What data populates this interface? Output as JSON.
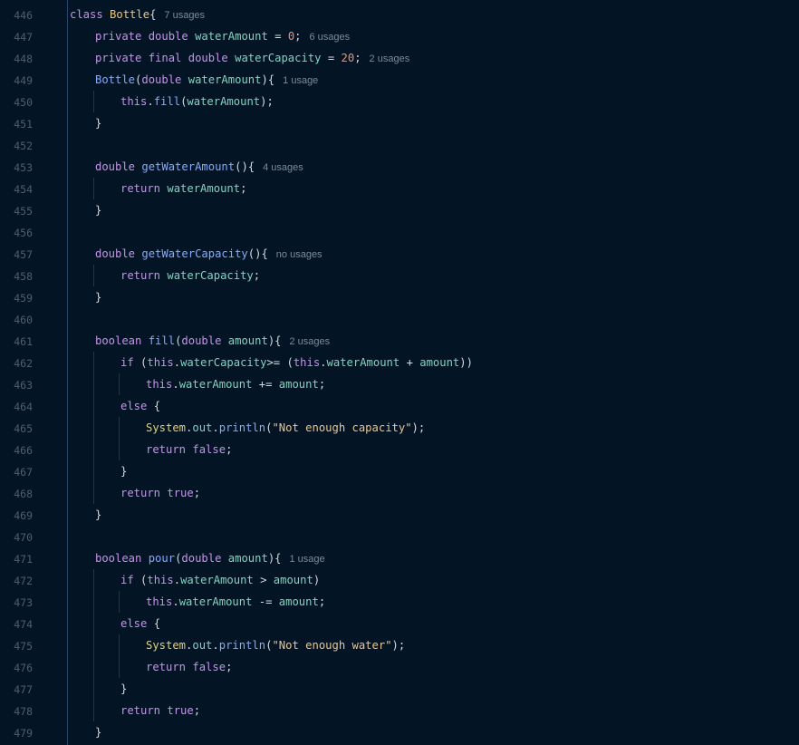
{
  "editor": {
    "line_numbers": [
      "446",
      "447",
      "448",
      "449",
      "450",
      "451",
      "452",
      "453",
      "454",
      "455",
      "456",
      "457",
      "458",
      "459",
      "460",
      "461",
      "462",
      "463",
      "464",
      "465",
      "466",
      "467",
      "468",
      "469",
      "470",
      "471",
      "472",
      "473",
      "474",
      "475",
      "476",
      "477",
      "478",
      "479"
    ],
    "lines": [
      {
        "indent": 0,
        "tokens": [
          [
            "kw",
            "class "
          ],
          [
            "cls",
            "Bottle"
          ],
          [
            "txt",
            "{"
          ]
        ],
        "hint": "7 usages"
      },
      {
        "indent": 1,
        "tokens": [
          [
            "kw",
            "private "
          ],
          [
            "kw",
            "double "
          ],
          [
            "fld",
            "waterAmount"
          ],
          [
            "txt",
            " = "
          ],
          [
            "num",
            "0"
          ],
          [
            "txt",
            ";"
          ]
        ],
        "hint": "6 usages"
      },
      {
        "indent": 1,
        "tokens": [
          [
            "kw",
            "private "
          ],
          [
            "kw",
            "final "
          ],
          [
            "kw",
            "double "
          ],
          [
            "fld",
            "waterCapacity"
          ],
          [
            "txt",
            " = "
          ],
          [
            "num",
            "20"
          ],
          [
            "txt",
            ";"
          ]
        ],
        "hint": "2 usages"
      },
      {
        "indent": 1,
        "tokens": [
          [
            "fn",
            "Bottle"
          ],
          [
            "txt",
            "("
          ],
          [
            "kw",
            "double "
          ],
          [
            "fld",
            "waterAmount"
          ],
          [
            "txt",
            "){"
          ]
        ],
        "hint": "1 usage"
      },
      {
        "indent": 2,
        "tokens": [
          [
            "kw",
            "this"
          ],
          [
            "txt",
            "."
          ],
          [
            "fn",
            "fill"
          ],
          [
            "txt",
            "("
          ],
          [
            "fld",
            "waterAmount"
          ],
          [
            "txt",
            ");"
          ]
        ]
      },
      {
        "indent": 1,
        "tokens": [
          [
            "txt",
            "}"
          ]
        ]
      },
      {
        "indent": 0,
        "tokens": []
      },
      {
        "indent": 1,
        "tokens": [
          [
            "kw",
            "double "
          ],
          [
            "fn",
            "getWaterAmount"
          ],
          [
            "txt",
            "(){"
          ]
        ],
        "hint": "4 usages"
      },
      {
        "indent": 2,
        "tokens": [
          [
            "kw",
            "return "
          ],
          [
            "fld",
            "waterAmount"
          ],
          [
            "txt",
            ";"
          ]
        ]
      },
      {
        "indent": 1,
        "tokens": [
          [
            "txt",
            "}"
          ]
        ]
      },
      {
        "indent": 0,
        "tokens": []
      },
      {
        "indent": 1,
        "tokens": [
          [
            "kw",
            "double "
          ],
          [
            "fn",
            "getWaterCapacity"
          ],
          [
            "txt",
            "(){"
          ]
        ],
        "hint": "no usages"
      },
      {
        "indent": 2,
        "tokens": [
          [
            "kw",
            "return "
          ],
          [
            "fld",
            "waterCapacity"
          ],
          [
            "txt",
            ";"
          ]
        ]
      },
      {
        "indent": 1,
        "tokens": [
          [
            "txt",
            "}"
          ]
        ]
      },
      {
        "indent": 0,
        "tokens": []
      },
      {
        "indent": 1,
        "tokens": [
          [
            "kw",
            "boolean "
          ],
          [
            "fn",
            "fill"
          ],
          [
            "txt",
            "("
          ],
          [
            "kw",
            "double "
          ],
          [
            "fld",
            "amount"
          ],
          [
            "txt",
            "){"
          ]
        ],
        "hint": "2 usages"
      },
      {
        "indent": 2,
        "tokens": [
          [
            "kw",
            "if "
          ],
          [
            "txt",
            "("
          ],
          [
            "kw",
            "this"
          ],
          [
            "txt",
            "."
          ],
          [
            "fld",
            "waterCapacity"
          ],
          [
            "txt",
            ">= ("
          ],
          [
            "kw",
            "this"
          ],
          [
            "txt",
            "."
          ],
          [
            "fld",
            "waterAmount"
          ],
          [
            "txt",
            " + "
          ],
          [
            "fld",
            "amount"
          ],
          [
            "txt",
            "))"
          ]
        ]
      },
      {
        "indent": 3,
        "tokens": [
          [
            "kw",
            "this"
          ],
          [
            "txt",
            "."
          ],
          [
            "fld",
            "waterAmount"
          ],
          [
            "txt",
            " += "
          ],
          [
            "fld",
            "amount"
          ],
          [
            "txt",
            ";"
          ]
        ]
      },
      {
        "indent": 2,
        "tokens": [
          [
            "kw",
            "else "
          ],
          [
            "txt",
            "{"
          ]
        ]
      },
      {
        "indent": 3,
        "tokens": [
          [
            "sys",
            "System"
          ],
          [
            "txt",
            "."
          ],
          [
            "fld",
            "out"
          ],
          [
            "txt",
            "."
          ],
          [
            "fn",
            "println"
          ],
          [
            "txt",
            "("
          ],
          [
            "str",
            "\"Not enough capacity\""
          ],
          [
            "txt",
            ");"
          ]
        ]
      },
      {
        "indent": 3,
        "tokens": [
          [
            "kw",
            "return "
          ],
          [
            "kw",
            "false"
          ],
          [
            "txt",
            ";"
          ]
        ]
      },
      {
        "indent": 2,
        "tokens": [
          [
            "txt",
            "}"
          ]
        ]
      },
      {
        "indent": 2,
        "tokens": [
          [
            "kw",
            "return "
          ],
          [
            "kw",
            "true"
          ],
          [
            "txt",
            ";"
          ]
        ]
      },
      {
        "indent": 1,
        "tokens": [
          [
            "txt",
            "}"
          ]
        ]
      },
      {
        "indent": 0,
        "tokens": []
      },
      {
        "indent": 1,
        "tokens": [
          [
            "kw",
            "boolean "
          ],
          [
            "fn",
            "pour"
          ],
          [
            "txt",
            "("
          ],
          [
            "kw",
            "double "
          ],
          [
            "fld",
            "amount"
          ],
          [
            "txt",
            "){"
          ]
        ],
        "hint": "1 usage"
      },
      {
        "indent": 2,
        "tokens": [
          [
            "kw",
            "if "
          ],
          [
            "txt",
            "("
          ],
          [
            "kw",
            "this"
          ],
          [
            "txt",
            "."
          ],
          [
            "fld",
            "waterAmount"
          ],
          [
            "txt",
            " > "
          ],
          [
            "fld",
            "amount"
          ],
          [
            "txt",
            ")"
          ]
        ]
      },
      {
        "indent": 3,
        "tokens": [
          [
            "kw",
            "this"
          ],
          [
            "txt",
            "."
          ],
          [
            "fld",
            "waterAmount"
          ],
          [
            "txt",
            " -= "
          ],
          [
            "fld",
            "amount"
          ],
          [
            "txt",
            ";"
          ]
        ]
      },
      {
        "indent": 2,
        "tokens": [
          [
            "kw",
            "else "
          ],
          [
            "txt",
            "{"
          ]
        ]
      },
      {
        "indent": 3,
        "tokens": [
          [
            "sys",
            "System"
          ],
          [
            "txt",
            "."
          ],
          [
            "fld",
            "out"
          ],
          [
            "txt",
            "."
          ],
          [
            "fn",
            "println"
          ],
          [
            "txt",
            "("
          ],
          [
            "str",
            "\"Not enough water\""
          ],
          [
            "txt",
            ");"
          ]
        ]
      },
      {
        "indent": 3,
        "tokens": [
          [
            "kw",
            "return "
          ],
          [
            "kw",
            "false"
          ],
          [
            "txt",
            ";"
          ]
        ]
      },
      {
        "indent": 2,
        "tokens": [
          [
            "txt",
            "}"
          ]
        ]
      },
      {
        "indent": 2,
        "tokens": [
          [
            "kw",
            "return "
          ],
          [
            "kw",
            "true"
          ],
          [
            "txt",
            ";"
          ]
        ]
      },
      {
        "indent": 1,
        "tokens": [
          [
            "txt",
            "}"
          ]
        ]
      }
    ]
  }
}
